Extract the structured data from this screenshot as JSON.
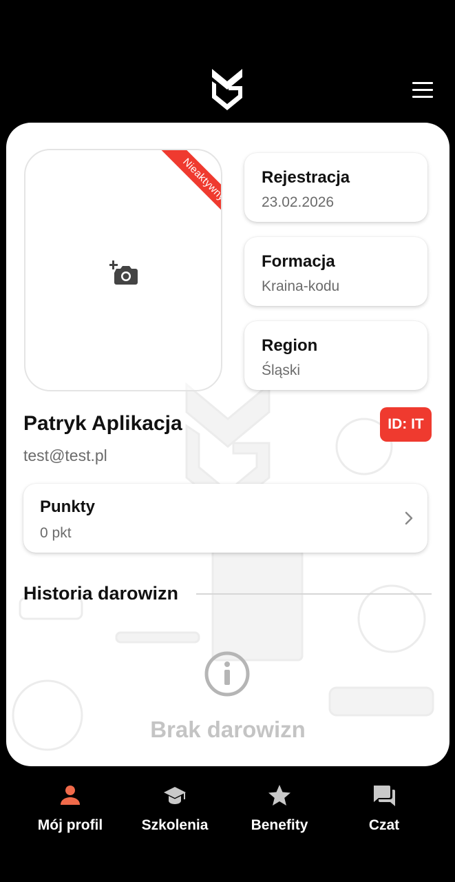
{
  "profile": {
    "status_ribbon": "Nieaktywny",
    "name": "Patryk Aplikacja",
    "email": "test@test.pl",
    "id_badge": "ID: IT"
  },
  "info_cards": [
    {
      "title": "Rejestracja",
      "value": "23.02.2026"
    },
    {
      "title": "Formacja",
      "value": "Kraina-kodu"
    },
    {
      "title": "Region",
      "value": "Śląski"
    }
  ],
  "points": {
    "title": "Punkty",
    "value": "0 pkt"
  },
  "history": {
    "title": "Historia darowizn",
    "empty_text": "Brak darowizn"
  },
  "bottom_nav": [
    {
      "label": "Mój profil",
      "icon": "person-icon",
      "active": true
    },
    {
      "label": "Szkolenia",
      "icon": "graduation-cap-icon",
      "active": false
    },
    {
      "label": "Benefity",
      "icon": "star-icon",
      "active": false
    },
    {
      "label": "Czat",
      "icon": "chat-icon",
      "active": false
    }
  ],
  "colors": {
    "accent": "#ef3a2f",
    "active_nav_icon": "#f06a4a",
    "inactive_nav_icon": "#c9c9c9",
    "background": "#000000"
  }
}
